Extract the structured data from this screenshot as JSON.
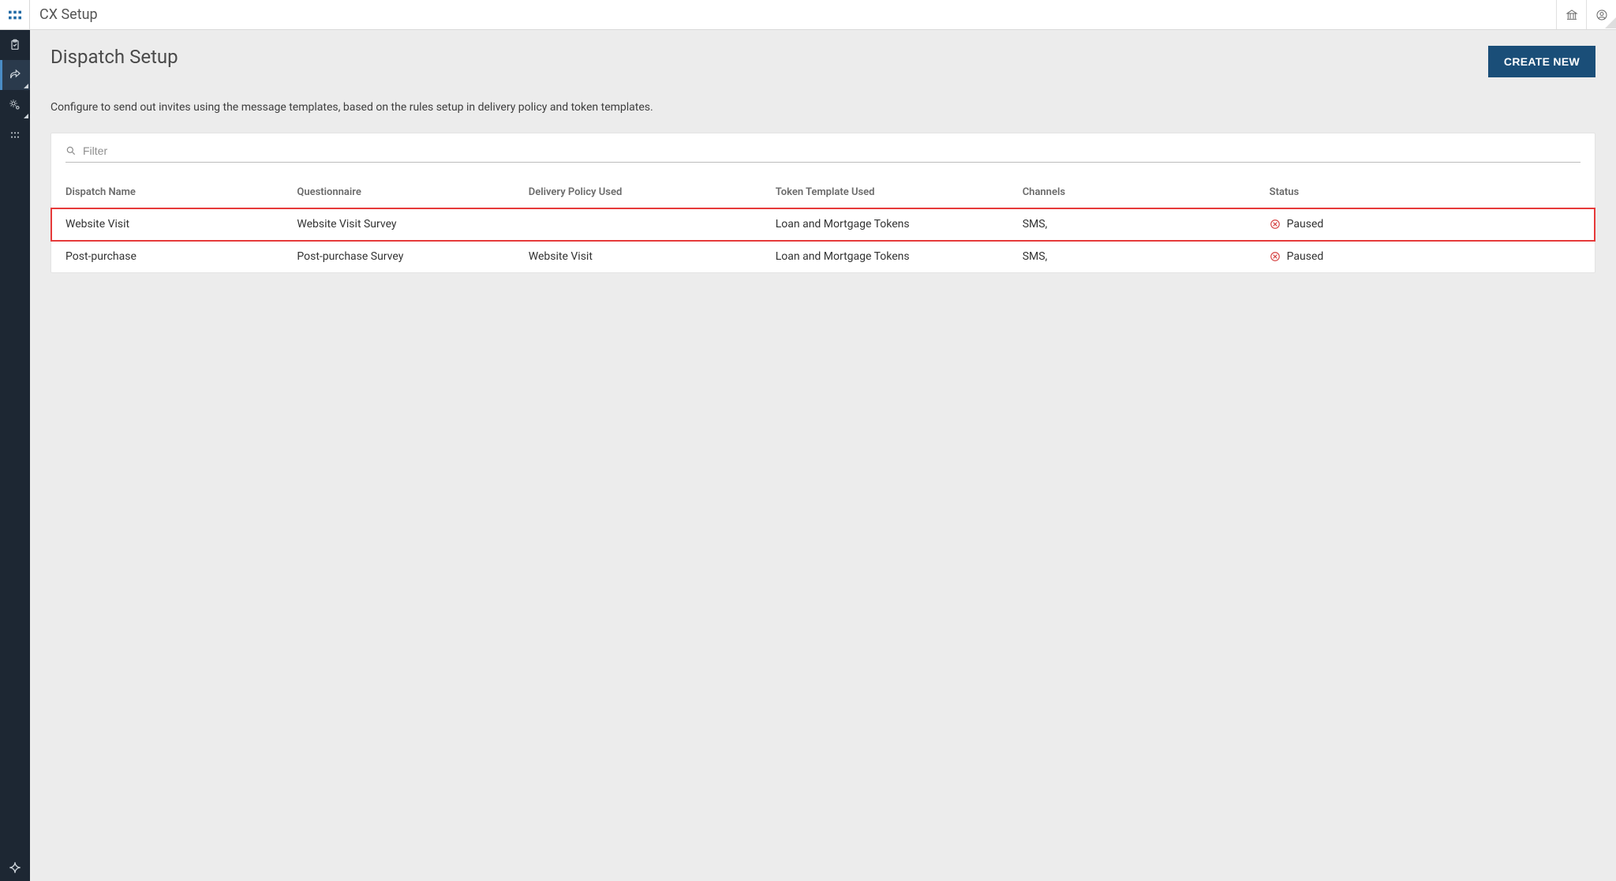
{
  "header": {
    "app_title": "CX Setup"
  },
  "page": {
    "title": "Dispatch Setup",
    "create_button_label": "CREATE NEW",
    "description": "Configure to send out invites using the message templates, based on the rules setup in delivery policy and token templates."
  },
  "filter": {
    "placeholder": "Filter"
  },
  "table": {
    "columns": {
      "dispatch_name": "Dispatch Name",
      "questionnaire": "Questionnaire",
      "delivery_policy": "Delivery Policy Used",
      "token_template": "Token Template Used",
      "channels": "Channels",
      "status": "Status"
    },
    "rows": [
      {
        "dispatch_name": "Website Visit",
        "questionnaire": "Website Visit Survey",
        "delivery_policy": "",
        "token_template": "Loan and Mortgage Tokens",
        "channels": "SMS,",
        "status": "Paused",
        "highlighted": true
      },
      {
        "dispatch_name": "Post-purchase",
        "questionnaire": "Post-purchase Survey",
        "delivery_policy": "Website Visit",
        "token_template": "Loan and Mortgage Tokens",
        "channels": "SMS,",
        "status": "Paused",
        "highlighted": false
      }
    ]
  }
}
